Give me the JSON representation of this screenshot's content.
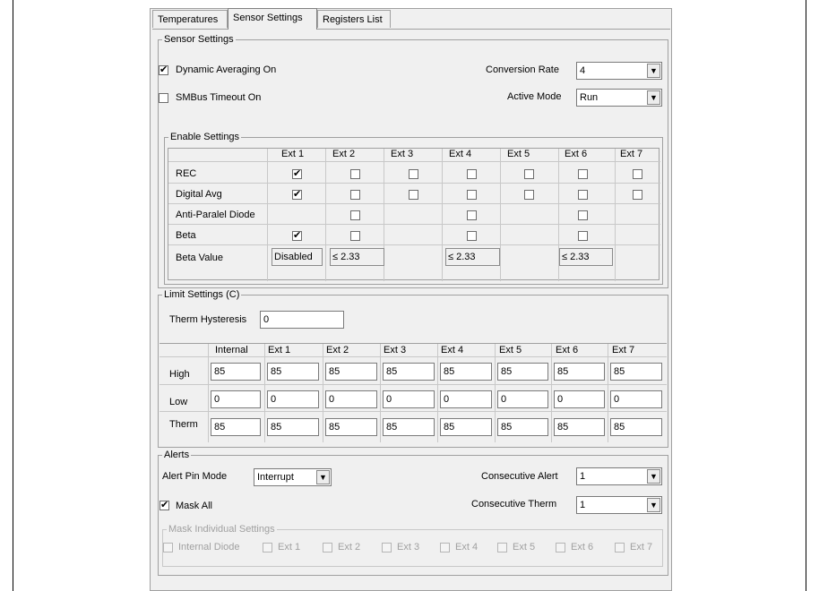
{
  "tabs": [
    {
      "label": "Temperatures"
    },
    {
      "label": "Sensor Settings"
    },
    {
      "label": "Registers List"
    }
  ],
  "sensor_settings": {
    "group_label": "Sensor Settings",
    "dynamic_averaging": {
      "label": "Dynamic Averaging On",
      "checked": true
    },
    "smbus_timeout": {
      "label": "SMBus Timeout On",
      "checked": false
    },
    "conversion_rate": {
      "label": "Conversion Rate",
      "value": "4"
    },
    "active_mode": {
      "label": "Active Mode",
      "value": "Run"
    }
  },
  "enable_settings": {
    "group_label": "Enable Settings",
    "columns": [
      "Ext 1",
      "Ext 2",
      "Ext 3",
      "Ext 4",
      "Ext 5",
      "Ext 6",
      "Ext 7"
    ],
    "rows": [
      {
        "label": "REC",
        "cells": [
          true,
          false,
          false,
          false,
          false,
          false,
          false
        ]
      },
      {
        "label": "Digital Avg",
        "cells": [
          true,
          false,
          false,
          false,
          false,
          false,
          false
        ]
      },
      {
        "label": "Anti-Paralel Diode",
        "cells": [
          null,
          false,
          null,
          false,
          null,
          false,
          null
        ]
      },
      {
        "label": "Beta",
        "cells": [
          true,
          false,
          null,
          false,
          null,
          false,
          null
        ]
      }
    ],
    "beta_value": {
      "label": "Beta Value",
      "cells": [
        "Disabled",
        "≤ 2.33",
        "",
        "≤ 2.33",
        "",
        "≤ 2.33",
        ""
      ]
    }
  },
  "limit_settings": {
    "group_label": "Limit Settings (C)",
    "therm_hysteresis": {
      "label": "Therm Hysteresis",
      "value": "0"
    },
    "columns": [
      "Internal",
      "Ext 1",
      "Ext 2",
      "Ext 3",
      "Ext 4",
      "Ext 5",
      "Ext 6",
      "Ext 7"
    ],
    "rows": [
      {
        "label": "High",
        "values": [
          "85",
          "85",
          "85",
          "85",
          "85",
          "85",
          "85",
          "85"
        ]
      },
      {
        "label": "Low",
        "values": [
          "0",
          "0",
          "0",
          "0",
          "0",
          "0",
          "0",
          "0"
        ]
      },
      {
        "label": "Therm",
        "values": [
          "85",
          "85",
          "85",
          "85",
          "85",
          "85",
          "85",
          "85"
        ]
      }
    ]
  },
  "alerts": {
    "group_label": "Alerts",
    "alert_pin_mode": {
      "label": "Alert Pin Mode",
      "value": "Interrupt"
    },
    "consecutive_alert": {
      "label": "Consecutive Alert",
      "value": "1"
    },
    "consecutive_therm": {
      "label": "Consecutive Therm",
      "value": "1"
    },
    "mask_all": {
      "label": "Mask All",
      "checked": true
    },
    "mask_individual": {
      "group_label": "Mask Individual Settings",
      "items": [
        "Internal Diode",
        "Ext 1",
        "Ext 2",
        "Ext 3",
        "Ext 4",
        "Ext 5",
        "Ext 6",
        "Ext 7"
      ]
    }
  }
}
